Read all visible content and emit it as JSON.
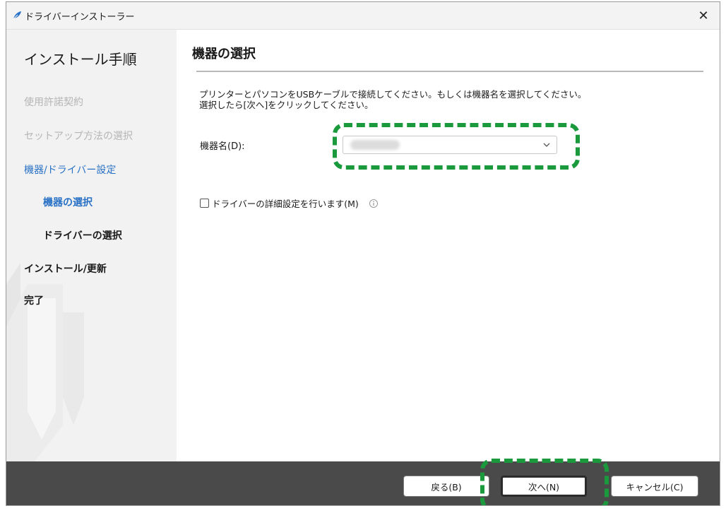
{
  "window": {
    "title": "ドライバーインストーラー",
    "close_glyph": "✕"
  },
  "sidebar": {
    "heading": "インストール手順",
    "steps": [
      {
        "label": "使用許諾契約",
        "state": "done"
      },
      {
        "label": "セットアップ方法の選択",
        "state": "done"
      },
      {
        "label": "機器/ドライバー設定",
        "state": "current"
      },
      {
        "label": "機器の選択",
        "state": "current-sub"
      },
      {
        "label": "ドライバーの選択",
        "state": "future-sub"
      },
      {
        "label": "インストール/更新",
        "state": "future"
      },
      {
        "label": "完了",
        "state": "future"
      }
    ]
  },
  "main": {
    "title": "機器の選択",
    "instruction_line1": "プリンターとパソコンをUSBケーブルで接続してください。もしくは機器名を選択してください。",
    "instruction_line2": "選択したら[次へ]をクリックしてください。",
    "device_label": "機器名(D):",
    "device_value": "",
    "advanced_checkbox_label": "ドライバーの詳細設定を行います(M)",
    "advanced_checked": false
  },
  "footer": {
    "back_label": "戻る(B)",
    "next_label": "次へ(N)",
    "cancel_label": "キャンセル(C)"
  },
  "colors": {
    "accent_blue": "#2a72c6",
    "highlight_green": "#1a9a3c",
    "footer_bg": "#4a4a4a",
    "sidebar_bg": "#f2f2f2"
  },
  "icons": {
    "app": "feather-icon",
    "close": "close-icon",
    "dropdown": "chevron-down-icon",
    "info": "info-icon"
  }
}
